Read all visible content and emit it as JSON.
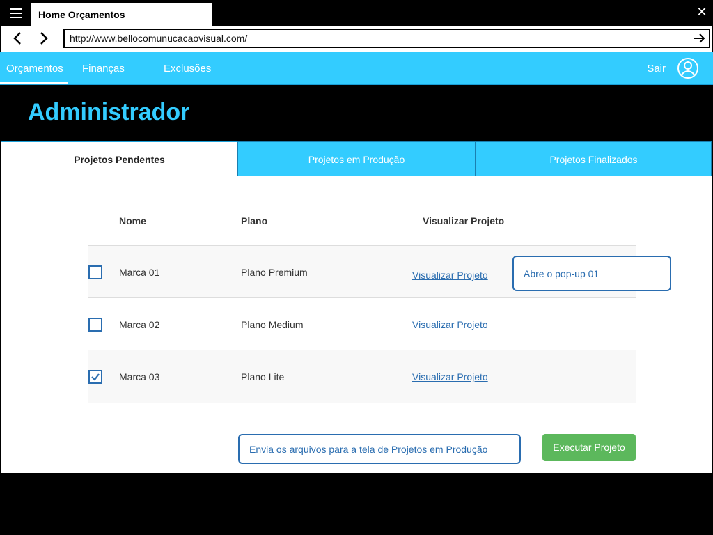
{
  "browser": {
    "tab_title": "Home Orçamentos",
    "url": "http://www.bellocomunucacaovisual.com/"
  },
  "appnav": {
    "items": [
      {
        "label": "Orçamentos",
        "active": true
      },
      {
        "label": "Finanças",
        "active": false
      },
      {
        "label": "Exclusões",
        "active": false
      }
    ],
    "logout_label": "Sair"
  },
  "header": {
    "title": "Administrador"
  },
  "tabs": [
    {
      "label": "Projetos Pendentes",
      "active": true
    },
    {
      "label": "Projetos em Produção",
      "active": false
    },
    {
      "label": "Projetos Finalizados",
      "active": false
    }
  ],
  "table": {
    "columns": [
      "Nome",
      "Plano",
      "Visualizar Projeto"
    ],
    "rows": [
      {
        "nome": "Marca 01",
        "plano": "Plano Premium",
        "link": "Visualizar Projeto",
        "checked": false
      },
      {
        "nome": "Marca 02",
        "plano": "Plano Medium",
        "link": "Visualizar Projeto",
        "checked": false
      },
      {
        "nome": "Marca 03",
        "plano": "Plano Lite",
        "link": "Visualizar Projeto",
        "checked": true
      }
    ]
  },
  "annotations": {
    "popup_note": "Abre o pop-up  01",
    "send_note": "Envia os arquivos para a tela de Projetos em Produção"
  },
  "actions": {
    "execute_label": "Executar Projeto"
  },
  "colors": {
    "accent": "#33ccff",
    "link": "#2a6db0",
    "success": "#5cb85c"
  }
}
